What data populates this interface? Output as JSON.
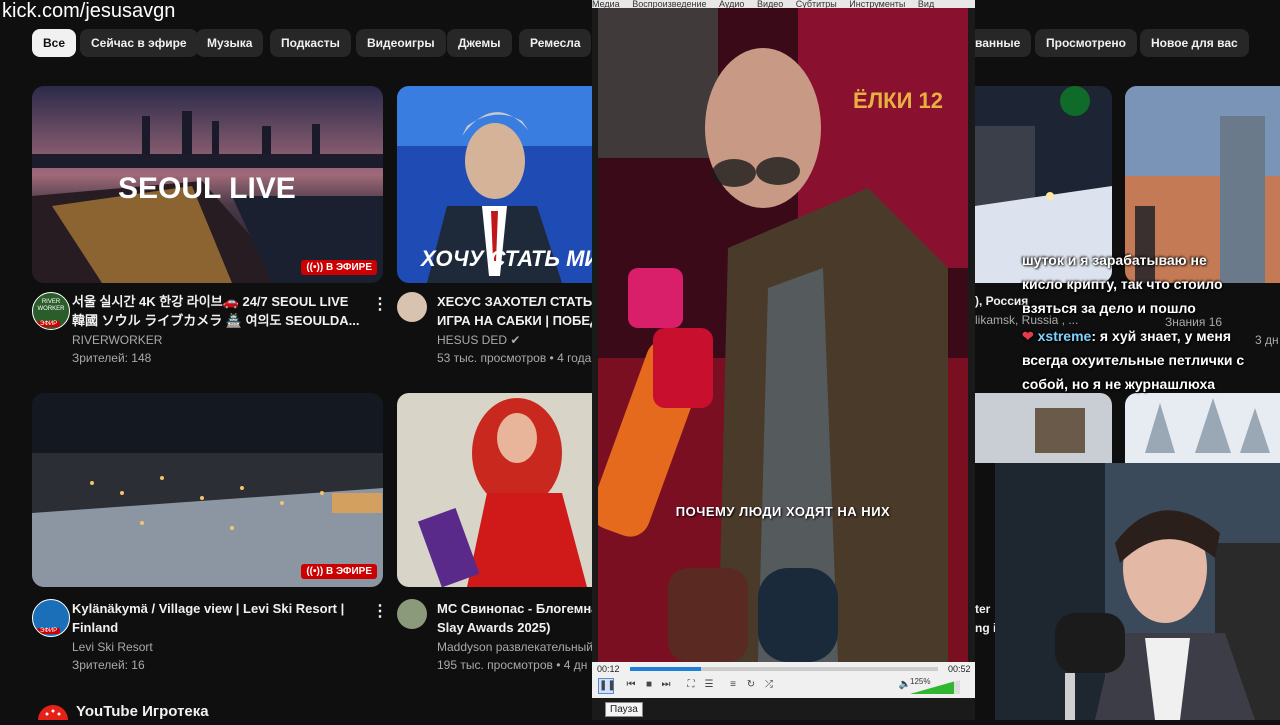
{
  "watermark": "kick.com/jesusavgn",
  "chips": [
    "Все",
    "Сейчас в эфире",
    "Музыка",
    "Подкасты",
    "Видеоигры",
    "Джемы",
    "Ремесла",
    "ванные",
    "Просмотрено",
    "Новое для вас"
  ],
  "videos": [
    {
      "thumb_text": "SEOUL LIVE",
      "badge": "В ЭФИРЕ",
      "title_line1": "서울 실시간 4K 한강 라이브🚗 24/7 SEOUL LIVE",
      "title_line2": "韓國 ソウル ライブカメラ 🏯 여의도 SEOULDA...",
      "channel": "RIVERWORKER",
      "stats": "Зрителей: 148",
      "avatar_text": "RIVER WORKER",
      "avatar_live": "ЭФИР"
    },
    {
      "thumb_text": "ХОЧУ СТАТЬ МИ",
      "title_line1": "ХЕСУС ЗАХОТЕЛ СТАТЬ М",
      "title_line2": "ИГРА НА САБКИ | ПОБЕД",
      "channel": "HESUS DED",
      "stats": "53 тыс. просмотров • 4 года"
    },
    {
      "badge": "В ЭФИРЕ",
      "title_line1": "Kylänäkymä / Village view | Levi Ski Resort |",
      "title_line2": "Finland",
      "channel": "Levi Ski Resort",
      "stats": "Зрителей: 16",
      "avatar_live": "ЭФИР"
    },
    {
      "title_line1": "МС Свинопас - Блогемна",
      "title_line2": "Slay Awards 2025)",
      "channel": "Maddyson развлекательный",
      "stats": "195 тыс. просмотров • 4 дн"
    }
  ],
  "right_meta": {
    "title1": "), Россия",
    "title2": "likamsk, Russia , ...",
    "channel2": "Знания 16",
    "day": "3 дн",
    "bottom_title1": "ter",
    "bottom_title2": "ng in"
  },
  "chat": {
    "line1": "шуток и я зарабатываю не",
    "line2": "кисло крипту, так что стоило",
    "line3": "взяться за дело и пошло",
    "user": "xstreme",
    "msg1": ": я хуй знает, у меня",
    "msg2": "всегда охуительные петлички с",
    "msg3": "собой, но я не журнашлюха"
  },
  "section_title": "YouTube Игротека",
  "vlc": {
    "menu": [
      "Медиа",
      "Воспроизведение",
      "Аудио",
      "Видео",
      "Субтитры",
      "Инструменты",
      "Вид"
    ],
    "subtitle": "ПОЧЕМУ ЛЮДИ ХОДЯТ НА НИХ",
    "sign_text": "ЁЛКИ 12",
    "time_current": "00:12",
    "time_total": "00:52",
    "progress": 0.23,
    "volume": "125%",
    "tooltip": "Пауза"
  },
  "colors": {
    "accent_live": "#cc0000",
    "carpet": "#7a0f22",
    "progress": "#1e7fd6"
  }
}
